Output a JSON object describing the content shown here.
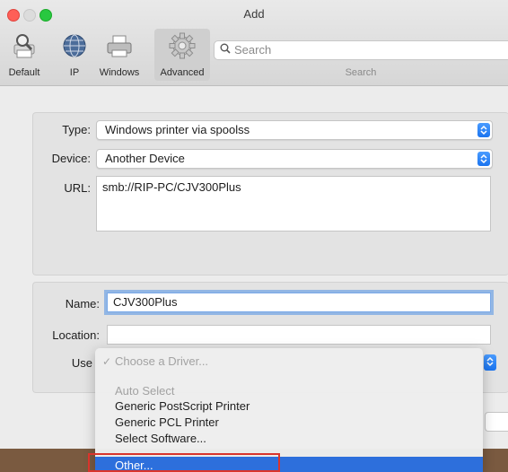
{
  "window": {
    "title": "Add"
  },
  "toolbar": {
    "buttons": [
      {
        "label": "Default",
        "icon": "default-printer-icon"
      },
      {
        "label": "IP",
        "icon": "ip-globe-icon"
      },
      {
        "label": "Windows",
        "icon": "windows-printer-icon"
      },
      {
        "label": "Advanced",
        "icon": "gear-icon"
      }
    ],
    "search": {
      "placeholder": "Search",
      "label": "Search"
    }
  },
  "form": {
    "type": {
      "label": "Type:",
      "value": "Windows printer via spoolss"
    },
    "device": {
      "label": "Device:",
      "value": "Another Device"
    },
    "url": {
      "label": "URL:",
      "value": "smb://RIP-PC/CJV300Plus"
    },
    "name": {
      "label": "Name:",
      "value": "CJV300Plus"
    },
    "location": {
      "label": "Location:",
      "value": ""
    },
    "use": {
      "label": "Use"
    }
  },
  "driver_menu": {
    "selected": "Choose a Driver...",
    "items": [
      "Auto Select",
      "Generic PostScript Printer",
      "Generic PCL Printer",
      "Select Software...",
      "Other..."
    ]
  },
  "colors": {
    "accent": "#2d6fdc",
    "highlight_box": "#d9342c"
  }
}
